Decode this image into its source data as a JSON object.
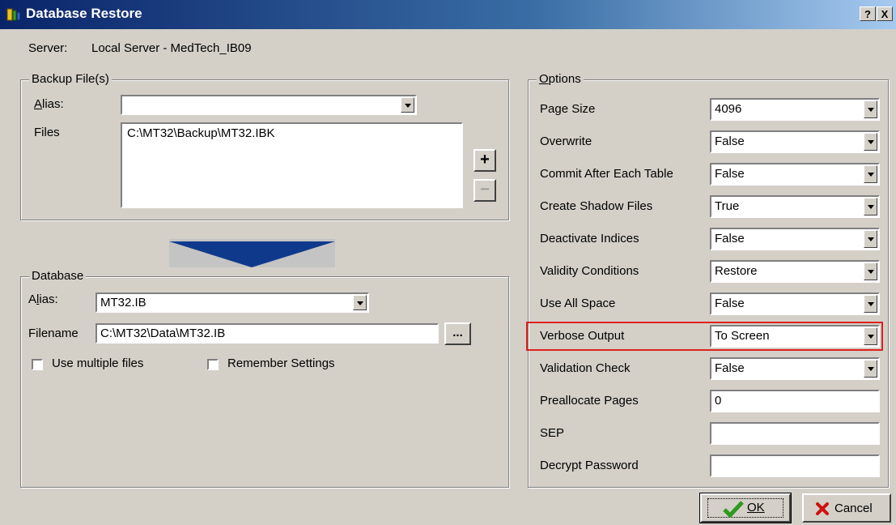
{
  "window": {
    "title": "Database Restore",
    "help_button": "?",
    "close_button": "X"
  },
  "server": {
    "label": "Server:",
    "value": "Local Server - MedTech_IB09"
  },
  "backup": {
    "group_label": "Backup File(s)",
    "alias_label": "Alias:",
    "alias_value": "",
    "files_label": "Files",
    "files": [
      "C:\\MT32\\Backup\\MT32.IBK"
    ],
    "add_button": "+",
    "remove_button": "−"
  },
  "database": {
    "group_label": "Database",
    "alias_label": "Alias:",
    "alias_value": "MT32.IB",
    "filename_label": "Filename",
    "filename_value": "C:\\MT32\\Data\\MT32.IB",
    "browse_button": "...",
    "use_multiple_files": "Use multiple files",
    "remember_settings": "Remember Settings"
  },
  "options": {
    "group_label": "Options",
    "rows": [
      {
        "label": "Page Size",
        "value": "4096",
        "type": "combo"
      },
      {
        "label": "Overwrite",
        "value": "False",
        "type": "combo"
      },
      {
        "label": "Commit After Each Table",
        "value": "False",
        "type": "combo"
      },
      {
        "label": "Create Shadow Files",
        "value": "True",
        "type": "combo"
      },
      {
        "label": "Deactivate Indices",
        "value": "False",
        "type": "combo"
      },
      {
        "label": "Validity Conditions",
        "value": "Restore",
        "type": "combo"
      },
      {
        "label": "Use All Space",
        "value": "False",
        "type": "combo"
      },
      {
        "label": "Verbose Output",
        "value": "To Screen",
        "type": "combo",
        "highlighted": true
      },
      {
        "label": "Validation Check",
        "value": "False",
        "type": "combo"
      },
      {
        "label": "Preallocate Pages",
        "value": "0",
        "type": "text"
      },
      {
        "label": "SEP",
        "value": "",
        "type": "text"
      },
      {
        "label": "Decrypt Password",
        "value": "",
        "type": "text"
      }
    ]
  },
  "buttons": {
    "ok": "OK",
    "cancel": "Cancel"
  },
  "colors": {
    "highlight": "#e0201c",
    "ok_check": "#2e9a1e",
    "cancel_x": "#d01010",
    "arrow": "#0f3a8c"
  }
}
